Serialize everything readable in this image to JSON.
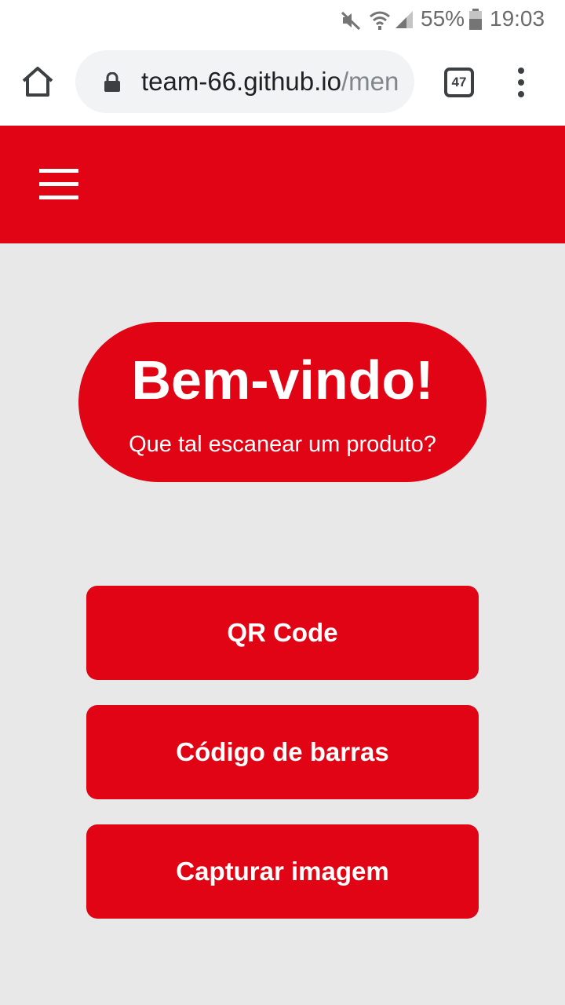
{
  "status_bar": {
    "battery_percent": "55%",
    "time": "19:03"
  },
  "browser": {
    "url_domain": "team-66.github.io",
    "url_rest": "/menu",
    "tab_count": "47"
  },
  "welcome": {
    "title": "Bem-vindo!",
    "subtitle": "Que tal escanear um produto?"
  },
  "actions": {
    "qr_code": "QR Code",
    "barcode": "Código de barras",
    "capture_image": "Capturar imagem"
  },
  "colors": {
    "brand_red": "#e10414",
    "background": "#e8e8e8"
  },
  "icons": [
    "mute-icon",
    "wifi-icon",
    "signal-icon",
    "battery-icon",
    "home-icon",
    "lock-icon",
    "tabs-icon",
    "more-menu-icon",
    "hamburger-icon"
  ]
}
